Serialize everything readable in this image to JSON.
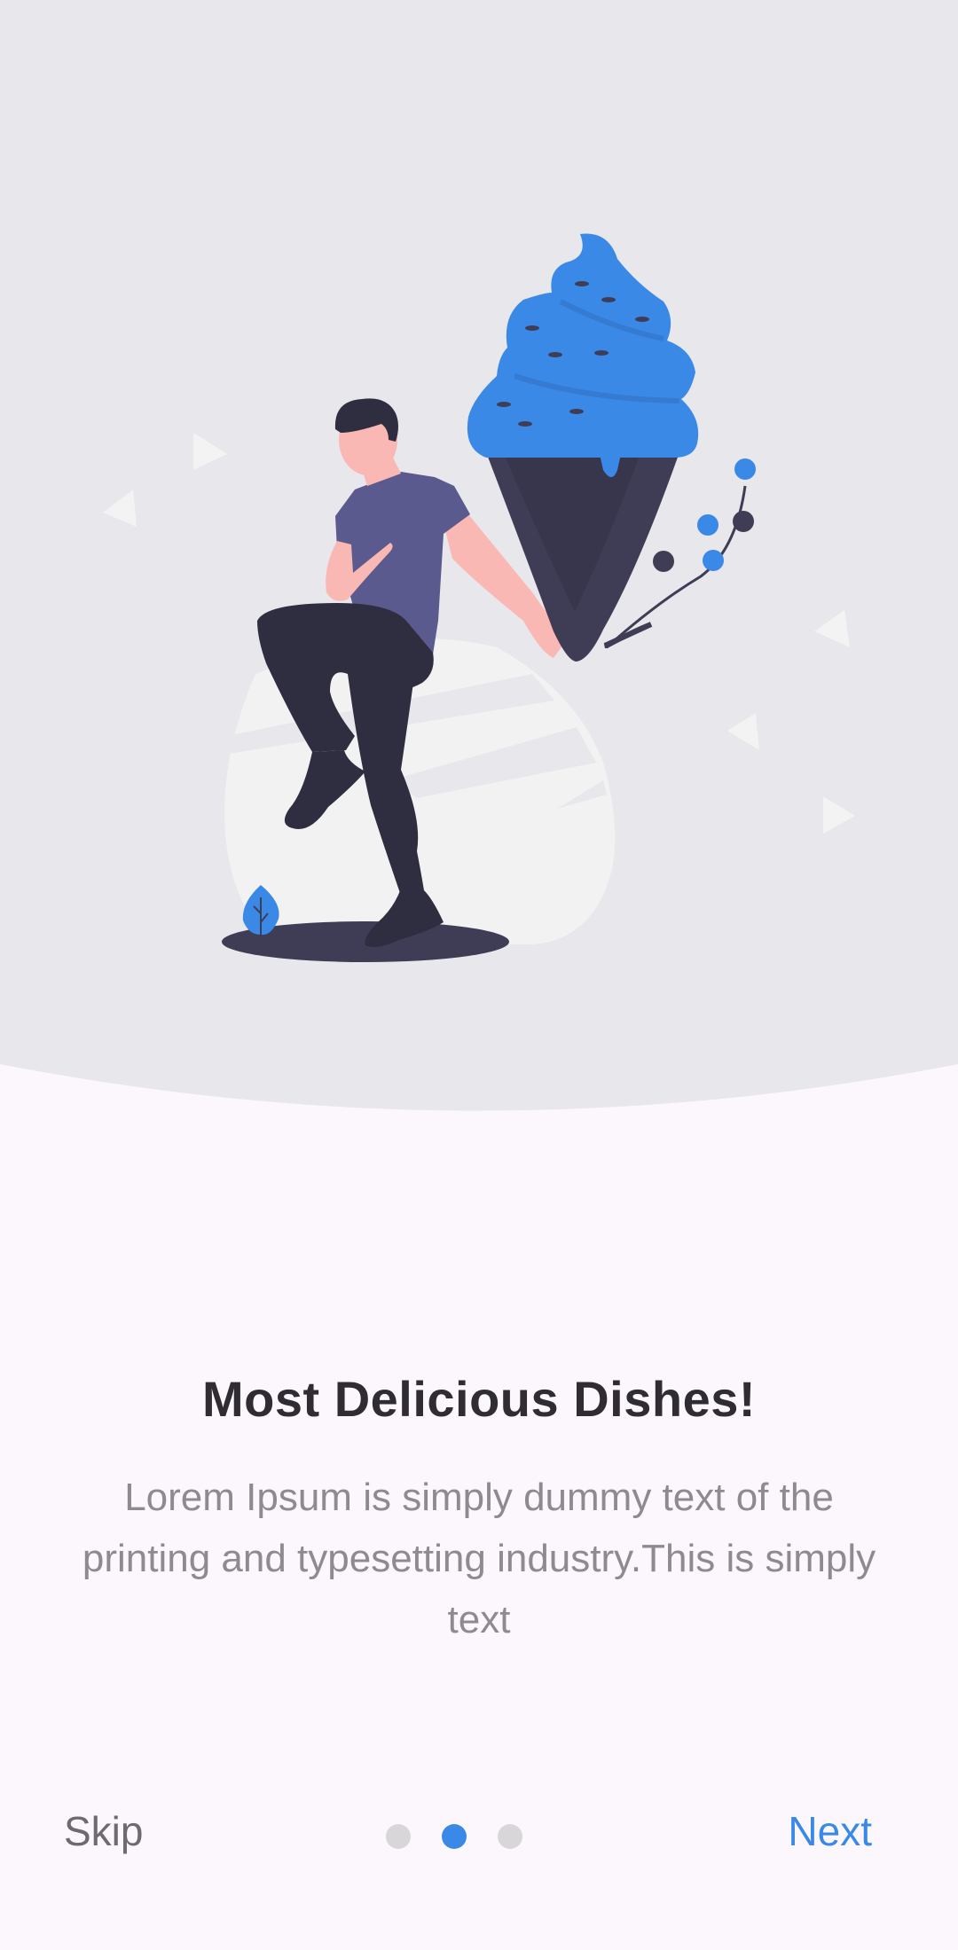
{
  "onboarding": {
    "title": "Most Delicious Dishes!",
    "description": "Lorem Ipsum is simply dummy text of the printing and typesetting industry.This is simply text",
    "illustration": "person-with-ice-cream-illustration"
  },
  "navigation": {
    "skip_label": "Skip",
    "next_label": "Next"
  },
  "pager": {
    "page_count": 3,
    "active_index": 1
  },
  "colors": {
    "accent": "#3a89e6",
    "hero_background": "#e8e7eb",
    "page_background": "#fcf7fc",
    "title": "#2f2d33",
    "body_text": "#8f8a90",
    "dot_inactive": "#d9d6da"
  }
}
